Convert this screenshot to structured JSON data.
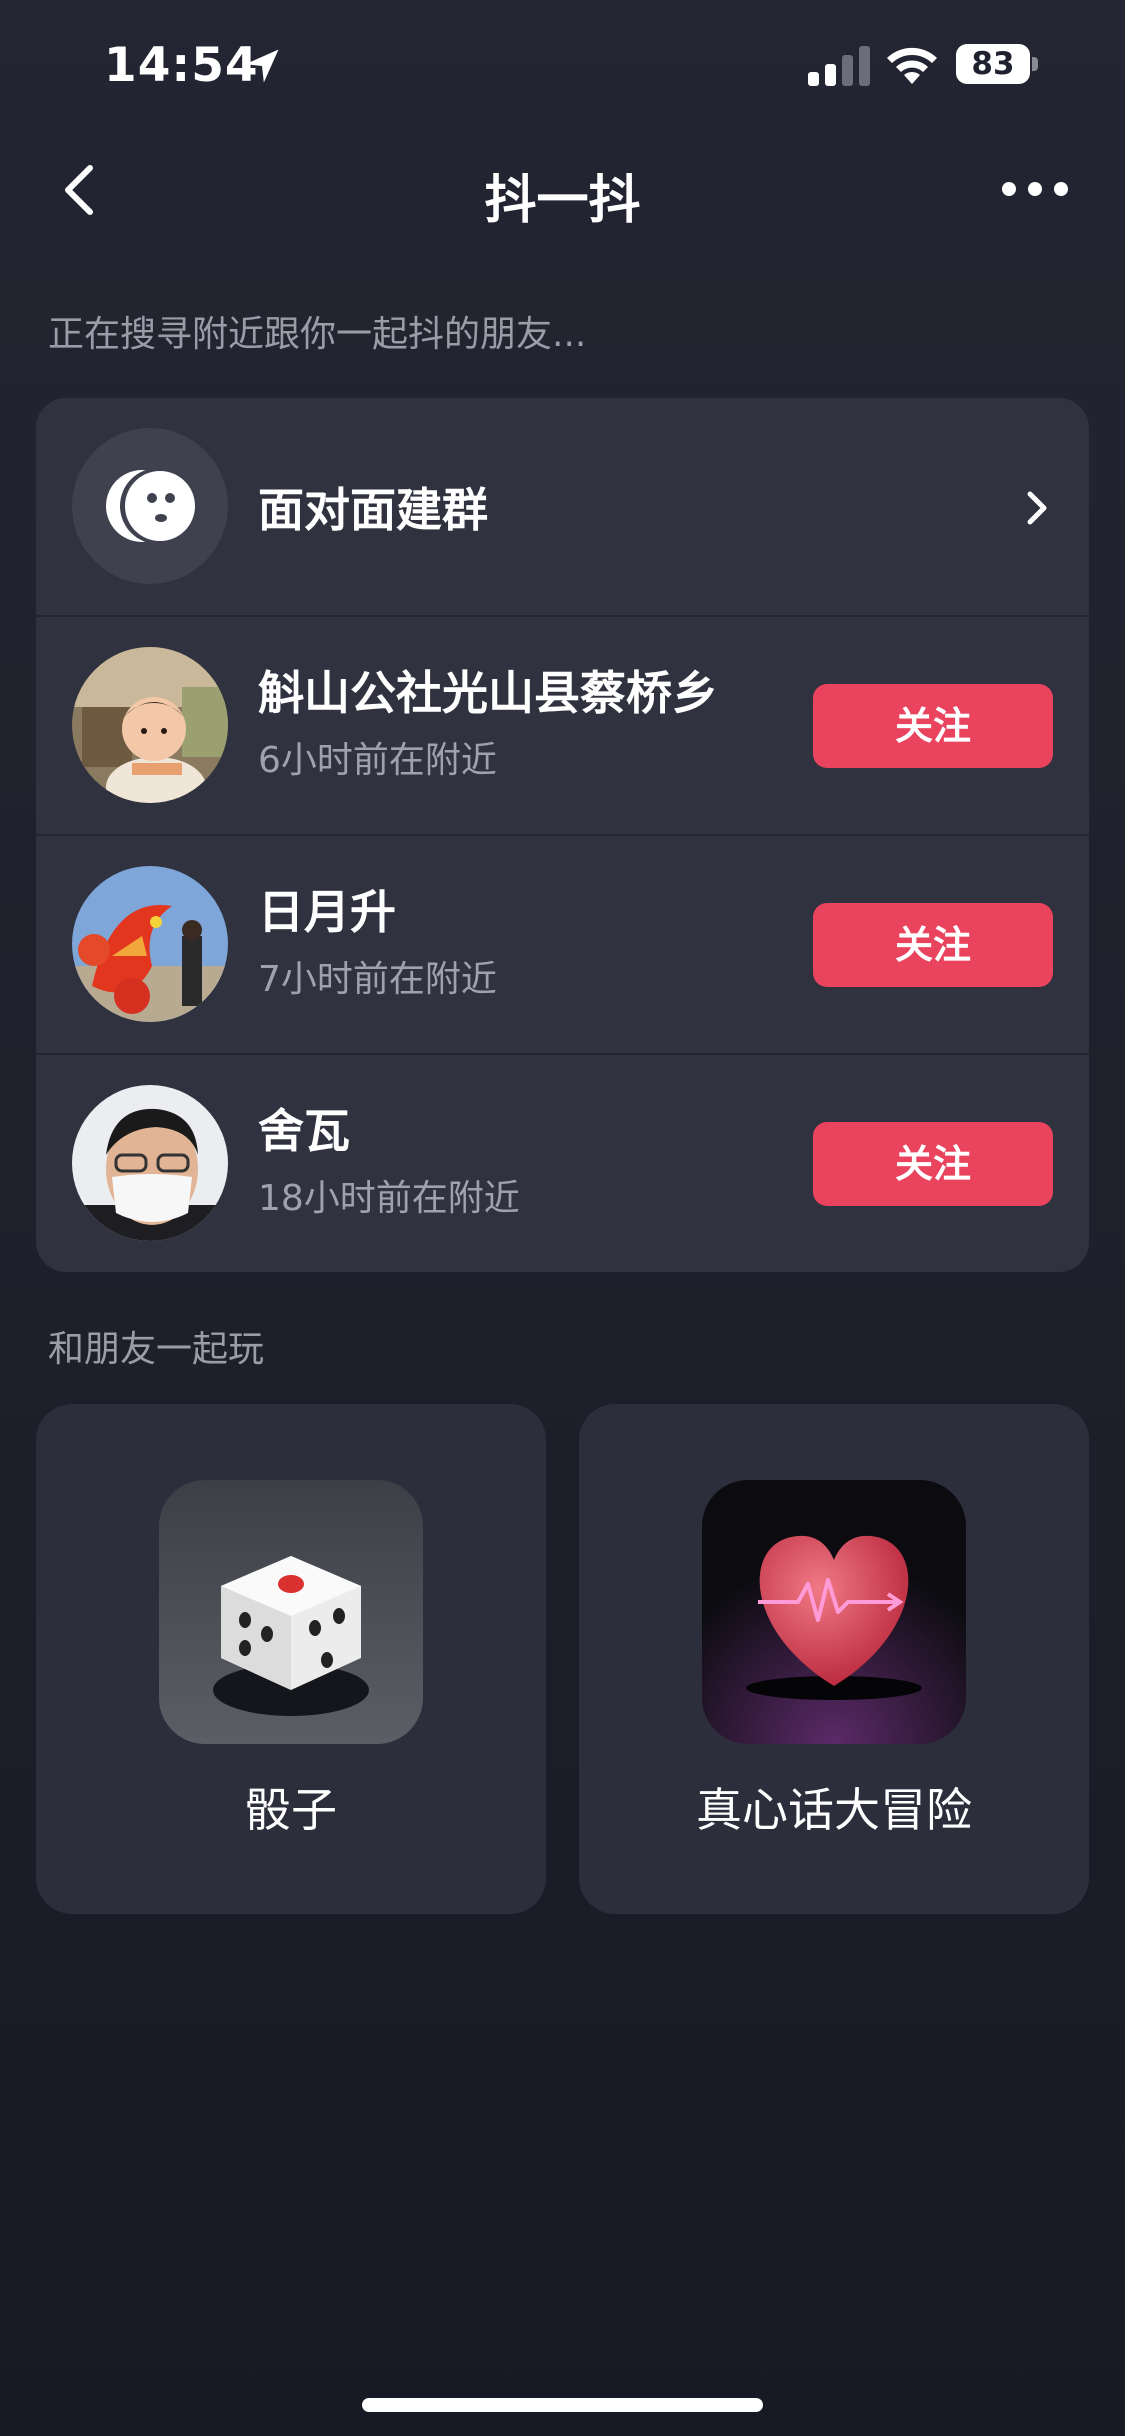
{
  "status": {
    "time": "14:54",
    "battery": "83"
  },
  "nav": {
    "title": "抖一抖"
  },
  "hint": "正在搜寻附近跟你一起抖的朋友...",
  "group": {
    "label": "面对面建群"
  },
  "users": [
    {
      "name": "斛山公社光山县蔡桥乡",
      "subtitle": "6小时前在附近",
      "action": "关注"
    },
    {
      "name": "日月升",
      "subtitle": "7小时前在附近",
      "action": "关注"
    },
    {
      "name": "舍瓦",
      "subtitle": "18小时前在附近",
      "action": "关注"
    }
  ],
  "play_section": {
    "title": "和朋友一起玩",
    "games": [
      {
        "label": "骰子",
        "icon": "dice-icon"
      },
      {
        "label": "真心话大冒险",
        "icon": "heart-pulse-icon"
      }
    ]
  },
  "colors": {
    "accent": "#e9435d",
    "card": "#30323f",
    "background": "#1d1f2b"
  }
}
